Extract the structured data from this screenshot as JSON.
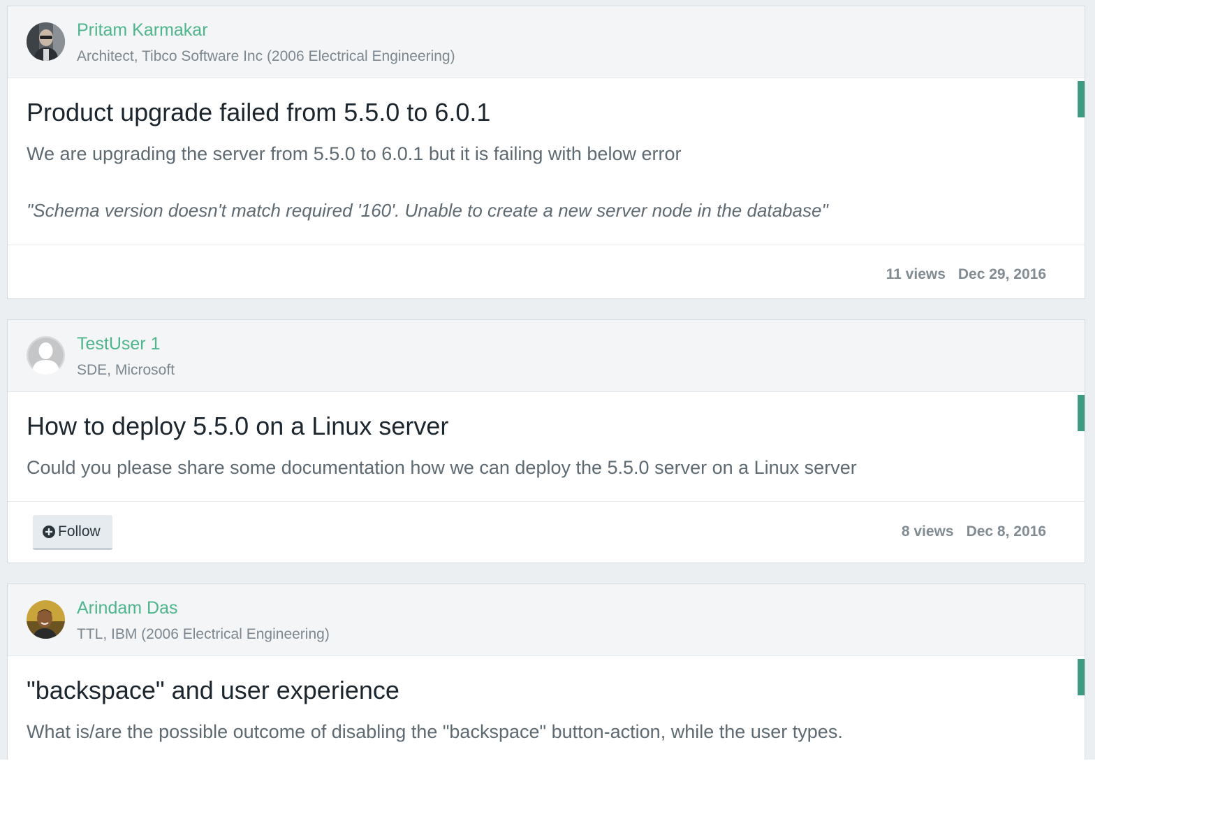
{
  "posts": [
    {
      "author": {
        "name": "Pritam Karmakar",
        "title": "Architect, Tibco Software Inc (2006 Electrical Engineering)",
        "avatar_icon": "user-photo-avatar"
      },
      "title": "Product upgrade failed from 5.5.0 to 6.0.1",
      "body": "We are upgrading the server from 5.5.0 to 6.0.1 but it is failing with below error",
      "quote": "\"Schema version doesn't match required '160'. Unable to create a new server node in the database\"",
      "views": "11 views",
      "date": "Dec 29, 2016"
    },
    {
      "author": {
        "name": "TestUser 1",
        "title": "SDE, Microsoft",
        "avatar_icon": "default-user-avatar"
      },
      "title": "How to deploy 5.5.0 on a Linux server",
      "body": "Could you please share some documentation how we can deploy the 5.5.0 server on a Linux server",
      "follow_label": "Follow",
      "follow_icon": "plus-circle-icon",
      "views": "8 views",
      "date": "Dec 8, 2016"
    },
    {
      "author": {
        "name": "Arindam Das",
        "title": "TTL, IBM (2006 Electrical Engineering)",
        "avatar_icon": "user-photo-avatar"
      },
      "title": "\"backspace\" and user experience",
      "body": "What is/are the possible outcome of disabling the \"backspace\" button-action, while the user types."
    }
  ],
  "colors": {
    "author_link": "#4fb58d",
    "accent_bar": "#3f9a82",
    "page_background": "#eceff1"
  }
}
